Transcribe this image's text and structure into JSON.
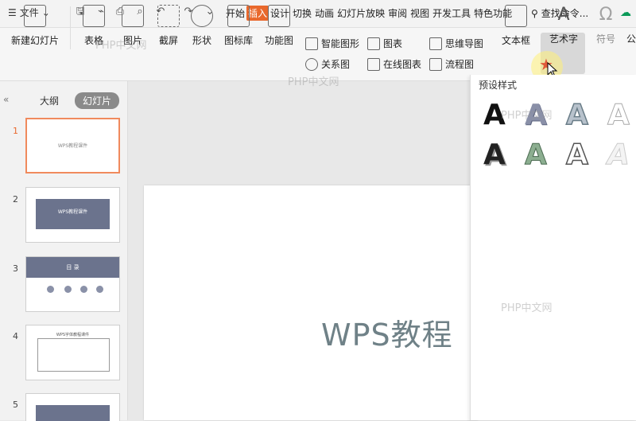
{
  "menubar": {
    "file_label": "文件",
    "tabs": [
      "开始",
      "插入",
      "设计",
      "切换",
      "动画",
      "幻灯片放映",
      "审阅",
      "视图",
      "开发工具",
      "特色功能"
    ],
    "active_tab": "插入",
    "search_label": "查找命令..."
  },
  "ribbon": {
    "new_slide": "新建幻灯片",
    "table": "表格",
    "picture": "图片",
    "screenshot": "截屏",
    "shape": "形状",
    "icon_lib": "图标库",
    "func_chart": "功能图",
    "smart_shape": "智能图形",
    "chart": "图表",
    "relation": "关系图",
    "online_chart": "在线图表",
    "mindmap": "思维导图",
    "flowchart": "流程图",
    "textbox": "文本框",
    "art_text": "艺术字",
    "symbol": "符号",
    "formula": "公"
  },
  "panel": {
    "tab_outline": "大纲",
    "tab_slides": "幻灯片",
    "slides": [
      {
        "num": "1",
        "text": "WPS教程课件"
      },
      {
        "num": "2",
        "text": "WPS教程课件"
      },
      {
        "num": "3",
        "text": "目 录"
      },
      {
        "num": "4",
        "text": "WPS字体教程课件"
      },
      {
        "num": "5",
        "text": ""
      }
    ]
  },
  "canvas": {
    "title": "WPS教程"
  },
  "dropdown": {
    "header": "预设样式",
    "letter": "A"
  },
  "watermark": "PHP中文网",
  "colors": {
    "accent": "#e9682c",
    "slide_blue": "#6b738d",
    "title_gray": "#6f8187"
  }
}
